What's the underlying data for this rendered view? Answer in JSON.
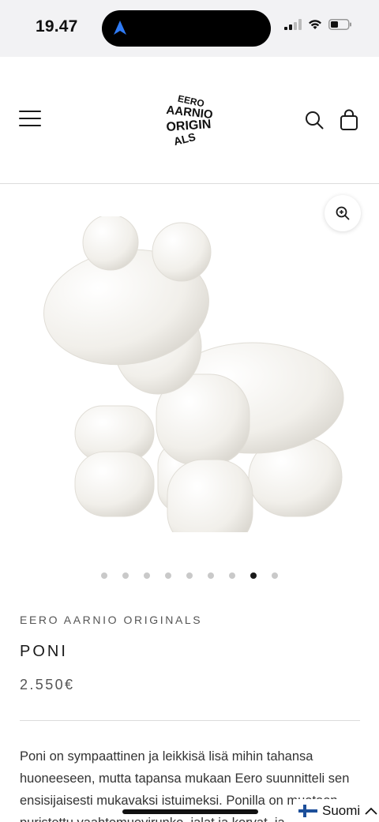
{
  "status_bar": {
    "time": "19.47"
  },
  "header": {
    "logo_text": "EERO AARNIO ORIGINALS",
    "logo_lines": [
      "EERO",
      "AARNIO",
      "ORIGIN",
      "ALS"
    ]
  },
  "gallery": {
    "slide_count": 9,
    "active_slide": 8
  },
  "product": {
    "vendor": "EERO AARNIO ORIGINALS",
    "title": "PONI",
    "price": "2.550€",
    "description": "Poni on sympaattinen ja leikkisä lisä mihin tahansa huoneeseen, mutta tapansa mukaan Eero suunnitteli sen ensisijaisesti mukavaksi istuimeksi. Ponilla on muotoon puristettu vaahtomuovirunko, jalat ja korvat, ja"
  },
  "language": {
    "label": "Suomi"
  },
  "colors": {
    "text": "#1a1a1a",
    "muted": "#555555",
    "divider": "#dcdcdc",
    "status_bar_bg": "#f2f2f4"
  }
}
